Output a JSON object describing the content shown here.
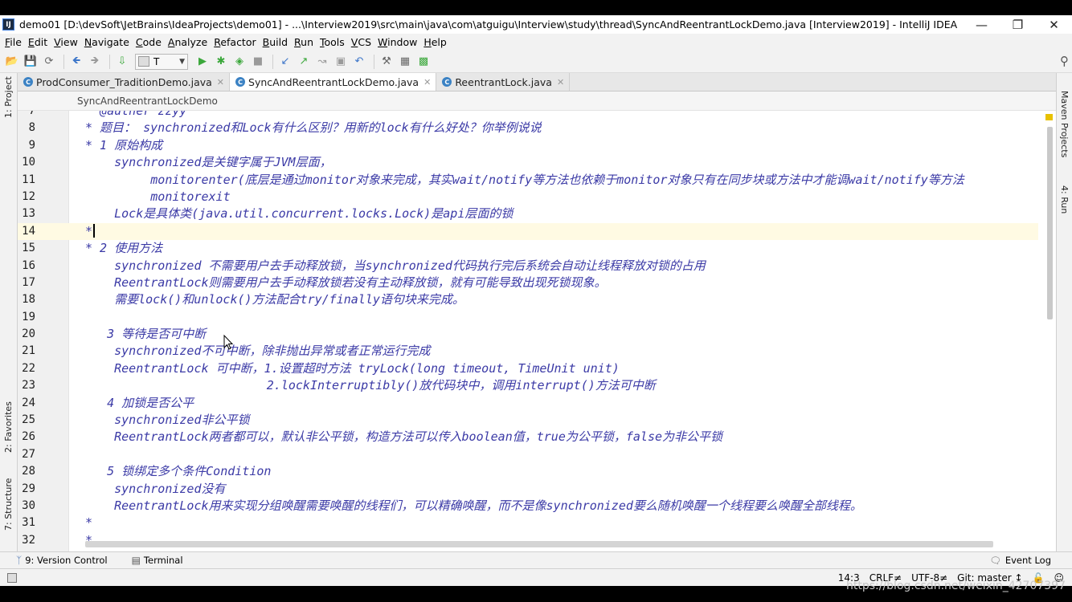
{
  "window": {
    "title": "demo01 [D:\\devSoft\\JetBrains\\IdeaProjects\\demo01] - ...\\Interview2019\\src\\main\\java\\com\\atguigu\\Interview\\study\\thread\\SyncAndReentrantLockDemo.java [Interview2019] - IntelliJ IDEA",
    "minimize": "—",
    "restore": "❐",
    "close": "✕"
  },
  "menu": [
    "File",
    "Edit",
    "View",
    "Navigate",
    "Code",
    "Analyze",
    "Refactor",
    "Build",
    "Run",
    "Tools",
    "VCS",
    "Window",
    "Help"
  ],
  "toolbar": {
    "run_config": "T"
  },
  "left_strip": {
    "project": "1: Project",
    "favorites": "2: Favorites",
    "structure": "7: Structure"
  },
  "right_strip": {
    "maven": "Maven Projects",
    "run": "4: Run"
  },
  "tabs": [
    {
      "label": "ProdConsumer_TraditionDemo.java",
      "active": false
    },
    {
      "label": "SyncAndReentrantLockDemo.java",
      "active": true
    },
    {
      "label": "ReentrantLock.java",
      "active": false
    }
  ],
  "breadcrumb": "SyncAndReentrantLockDemo",
  "editor": {
    "lines": [
      {
        "n": "7",
        "text": "  @auther zzyy"
      },
      {
        "n": "8",
        "text": "* 题目： synchronized和Lock有什么区别？用新的lock有什么好处？你举例说说"
      },
      {
        "n": "9",
        "text": "* 1 原始构成"
      },
      {
        "n": "10",
        "text": "    synchronized是关键字属于JVM层面，"
      },
      {
        "n": "11",
        "text": "         monitorenter(底层是通过monitor对象来完成，其实wait/notify等方法也依赖于monitor对象只有在同步块或方法中才能调wait/notify等方法"
      },
      {
        "n": "12",
        "text": "         monitorexit"
      },
      {
        "n": "13",
        "text": "    Lock是具体类(java.util.concurrent.locks.Lock)是api层面的锁"
      },
      {
        "n": "14",
        "text": "*"
      },
      {
        "n": "15",
        "text": "* 2 使用方法"
      },
      {
        "n": "16",
        "text": "    synchronized 不需要用户去手动释放锁，当synchronized代码执行完后系统会自动让线程释放对锁的占用"
      },
      {
        "n": "17",
        "text": "    ReentrantLock则需要用户去手动释放锁若没有主动释放锁，就有可能导致出现死锁现象。"
      },
      {
        "n": "18",
        "text": "    需要lock()和unlock()方法配合try/finally语句块来完成。"
      },
      {
        "n": "19",
        "text": ""
      },
      {
        "n": "20",
        "text": "   3 等待是否可中断"
      },
      {
        "n": "21",
        "text": "    synchronized不可中断，除非抛出异常或者正常运行完成"
      },
      {
        "n": "22",
        "text": "    ReentrantLock 可中断，1.设置超时方法 tryLock(long timeout, TimeUnit unit)"
      },
      {
        "n": "23",
        "text": "                         2.lockInterruptibly()放代码块中，调用interrupt()方法可中断"
      },
      {
        "n": "24",
        "text": "   4 加锁是否公平"
      },
      {
        "n": "25",
        "text": "    synchronized非公平锁"
      },
      {
        "n": "26",
        "text": "    ReentrantLock两者都可以，默认非公平锁，构造方法可以传入boolean值，true为公平锁，false为非公平锁"
      },
      {
        "n": "27",
        "text": ""
      },
      {
        "n": "28",
        "text": "   5 锁绑定多个条件Condition"
      },
      {
        "n": "29",
        "text": "    synchronized没有"
      },
      {
        "n": "30",
        "text": "    ReentrantLock用来实现分组唤醒需要唤醒的线程们，可以精确唤醒，而不是像synchronized要么随机唤醒一个线程要么唤醒全部线程。"
      },
      {
        "n": "31",
        "text": "*"
      },
      {
        "n": "32",
        "text": "*"
      }
    ],
    "current_line": "14"
  },
  "bottom_tools": {
    "version_control": "9: Version Control",
    "terminal": "Terminal",
    "event_log": "Event Log"
  },
  "status": {
    "position": "14:3",
    "line_sep": "CRLF≠",
    "encoding": "UTF-8≠",
    "git": "Git: master ↕"
  },
  "watermark": "https://blog.csdn.net/weixin_42707397"
}
